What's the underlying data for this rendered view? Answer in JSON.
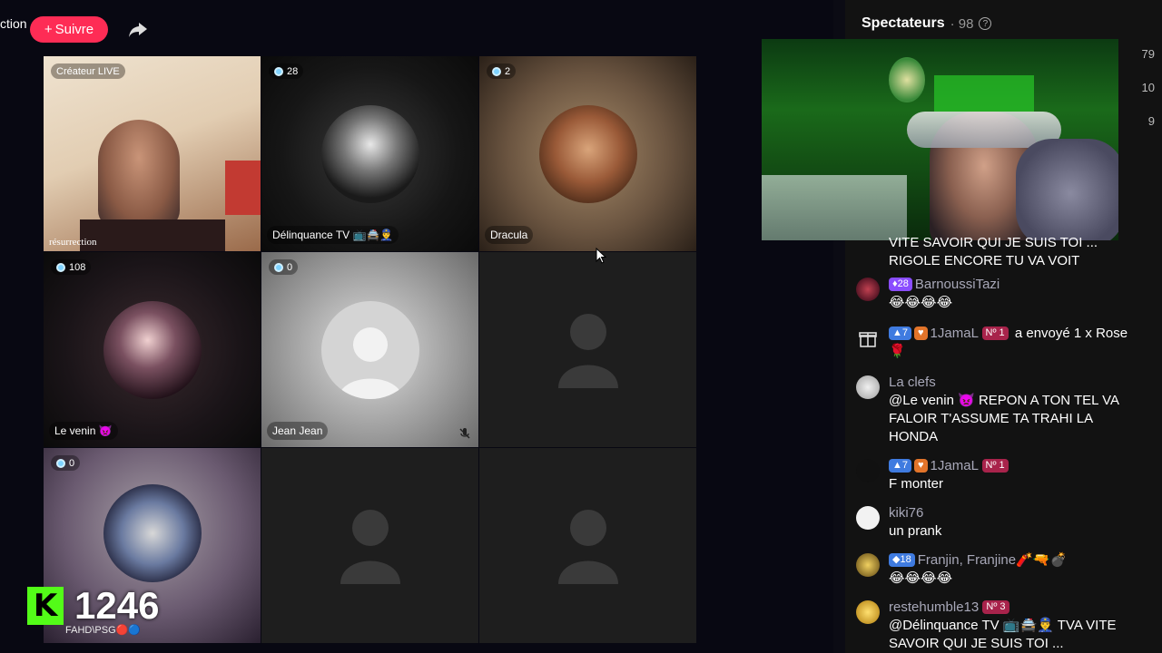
{
  "topbar": {
    "title_fragment": "ction",
    "follow_label": "Suivre"
  },
  "tiles": [
    {
      "badge": "",
      "top_label": "Créateur LIVE",
      "name": "résurrection"
    },
    {
      "badge": "28",
      "name": "Délinquance TV 📺🚔👮‍♂️"
    },
    {
      "badge": "2",
      "name": "Dracula"
    },
    {
      "badge": "108",
      "name": "Le venin 👿"
    },
    {
      "badge": "0",
      "name": "Jean Jean"
    },
    {
      "badge": "",
      "name": ""
    },
    {
      "badge": "0",
      "name": "FAHD\\PSG🔴🔵"
    },
    {
      "badge": "",
      "name": ""
    },
    {
      "badge": "",
      "name": ""
    }
  ],
  "kick": {
    "logo": "K",
    "count": "1246"
  },
  "panel": {
    "title": "Spectateurs",
    "count": "· 98",
    "help": "?",
    "right_numbers": [
      "79",
      "10",
      "9"
    ]
  },
  "chat": [
    {
      "user": "",
      "text": "VITE SAVOIR QUI JE SUIS TOI ... RIGOLE ENCORE TU VA VOIT"
    },
    {
      "user": "BarnoussiTazi",
      "badges": [
        "28"
      ],
      "text": "😂😂😂😂"
    },
    {
      "user": "1JamaL",
      "badges": [
        "7",
        "",
        "Nº 1"
      ],
      "text": "a envoyé 1 x Rose 🌹"
    },
    {
      "user": "La clefs",
      "badges": [],
      "text": "@Le venin 👿 REPON A TON TEL VA FALOIR T'ASSUME TA TRAHI LA HONDA"
    },
    {
      "user": "1JamaL",
      "badges": [
        "7",
        "",
        "Nº 1"
      ],
      "text": "F monter"
    },
    {
      "user": "kiki76",
      "badges": [],
      "text": "un prank"
    },
    {
      "user": "Franjin, Franjine🧨🔫💣",
      "badges": [
        "18"
      ],
      "text": "😂😂😂😂"
    },
    {
      "user": "restehumble13",
      "badges": [
        "Nº 3"
      ],
      "text": "@Délinquance TV 📺🚔👮‍♂️ TVA VITE SAVOIR QUI JE SUIS TOI ..."
    }
  ],
  "colors": {
    "accent": "#fe2c55",
    "kick_green": "#53fc18"
  }
}
